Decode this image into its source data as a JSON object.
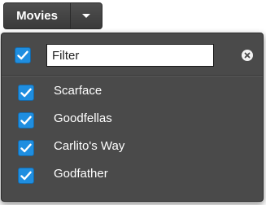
{
  "button": {
    "label": "Movies"
  },
  "filter": {
    "value": "Filter",
    "placeholder": "Filter"
  },
  "items": [
    {
      "label": "Scarface",
      "checked": true
    },
    {
      "label": "Goodfellas",
      "checked": true
    },
    {
      "label": "Carlito's Way",
      "checked": true
    },
    {
      "label": "Godfather",
      "checked": true
    }
  ],
  "colors": {
    "checkbox": "#1f8ee0",
    "panel": "#4a4a4a",
    "button": "#444444"
  },
  "icons": {
    "checkbox": "checkmark-icon",
    "toggle": "caret-down-icon",
    "clear": "clear-icon"
  }
}
